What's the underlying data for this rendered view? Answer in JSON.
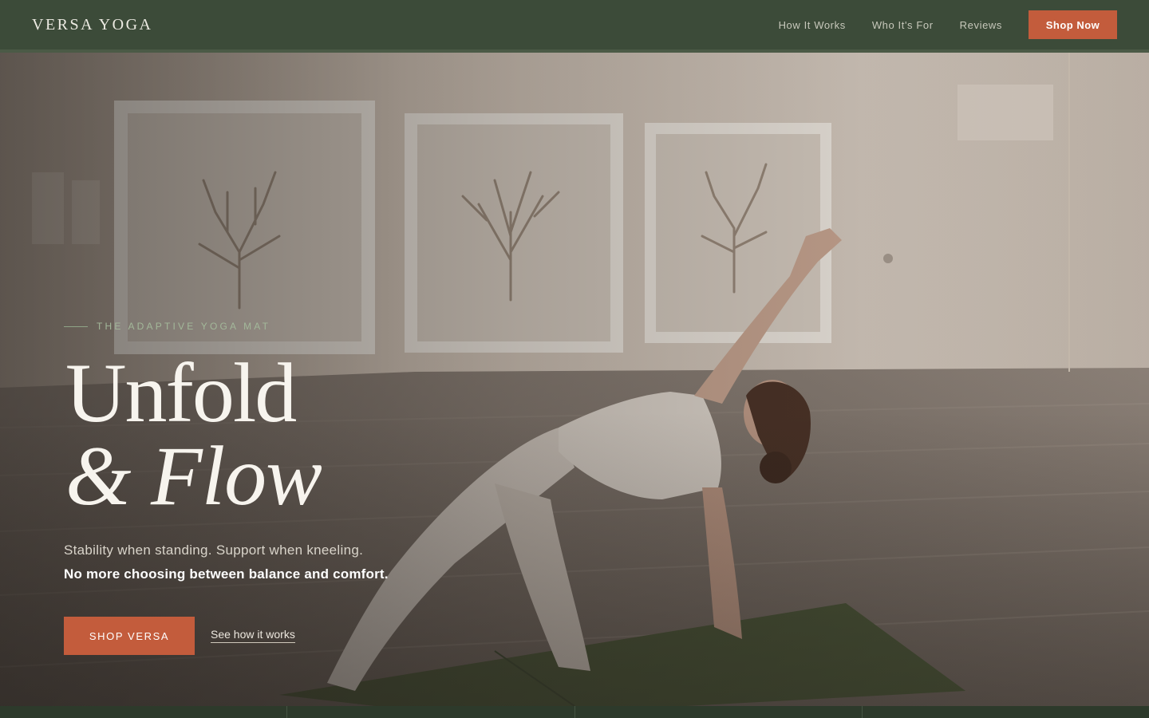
{
  "header": {
    "brand": "VERSA YOGA",
    "nav": [
      {
        "label": "How It Works"
      },
      {
        "label": "Who It's For"
      },
      {
        "label": "Reviews"
      }
    ],
    "cta_label": "Shop Now"
  },
  "hero": {
    "eyebrow": "THE ADAPTIVE YOGA MAT",
    "headline_line1": "Unfold",
    "headline_line2": "& Flow",
    "subline1": "Stability when standing. Support when kneeling.",
    "subline2": "No more choosing between balance and comfort.",
    "primary_cta": "SHOP VERSA",
    "secondary_cta": "See how it works"
  },
  "colors": {
    "header_bg": "#3c4b39",
    "accent": "#c35c3c",
    "eyebrow": "#a3b89a"
  }
}
